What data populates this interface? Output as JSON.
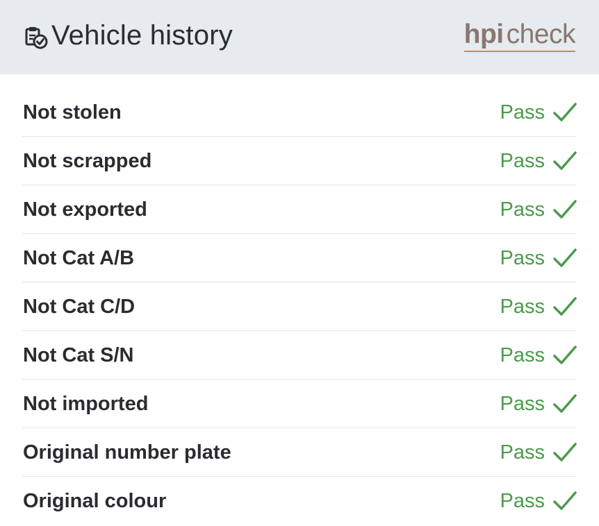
{
  "header": {
    "title": "Vehicle history",
    "icon": "clipboard-check-icon",
    "brand": {
      "hpi": "hpi",
      "check": "check",
      "underline_color": "#e5833a"
    }
  },
  "colors": {
    "pass": "#4b9a4b",
    "header_bg": "#e5ebef",
    "text": "#2c2b32"
  },
  "checks": [
    {
      "label": "Not stolen",
      "status": "Pass",
      "icon": "checkmark-icon"
    },
    {
      "label": "Not scrapped",
      "status": "Pass",
      "icon": "checkmark-icon"
    },
    {
      "label": "Not exported",
      "status": "Pass",
      "icon": "checkmark-icon"
    },
    {
      "label": "Not Cat A/B",
      "status": "Pass",
      "icon": "checkmark-icon"
    },
    {
      "label": "Not Cat C/D",
      "status": "Pass",
      "icon": "checkmark-icon"
    },
    {
      "label": "Not Cat S/N",
      "status": "Pass",
      "icon": "checkmark-icon"
    },
    {
      "label": "Not imported",
      "status": "Pass",
      "icon": "checkmark-icon"
    },
    {
      "label": "Original number plate",
      "status": "Pass",
      "icon": "checkmark-icon"
    },
    {
      "label": "Original colour",
      "status": "Pass",
      "icon": "checkmark-icon"
    }
  ]
}
